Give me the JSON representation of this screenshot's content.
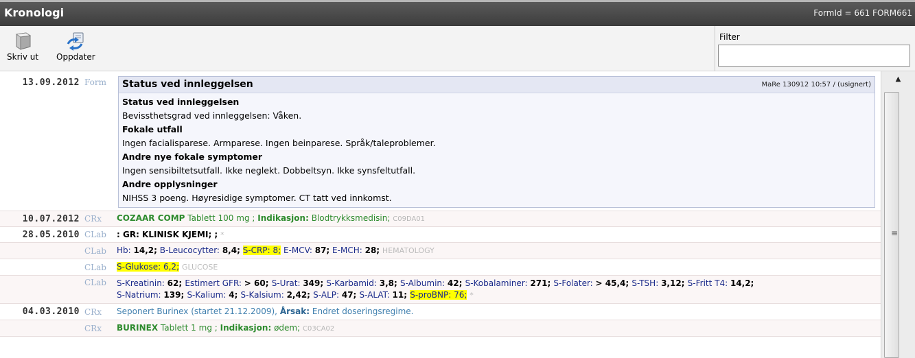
{
  "window": {
    "title": "Kronologi",
    "form_id": "FormId = 661 FORM661"
  },
  "toolbar": {
    "print": {
      "label": "Skriv ut",
      "icon": "printer-icon"
    },
    "refresh": {
      "label": "Oppdater",
      "icon": "refresh-icon"
    },
    "filter": {
      "label": "Filter",
      "value": ""
    }
  },
  "entries": {
    "e1": {
      "date": "13.09.2012",
      "type": "Form",
      "form_title": "Status ved innleggelsen",
      "signature": "MaRe 130912 10:57 / (usignert)",
      "lines": [
        "Status ved innleggelsen",
        "Bevissthetsgrad ved innleggelsen: Våken.",
        "Fokale utfall",
        "Ingen facialisparese. Armparese. Ingen beinparese. Språk/taleproblemer.",
        "Andre nye fokale symptomer",
        "Ingen sensibiltetsutfall. Ikke neglekt. Dobbeltsyn. Ikke synsfeltutfall.",
        "Andre opplysninger",
        "NIHSS 3 poeng. Høyresidige symptomer. CT tatt ved innkomst."
      ]
    },
    "e2": {
      "date": "10.07.2012",
      "type": "CRx",
      "drug": "COZAAR COMP",
      "form": "Tablett 100 mg ;",
      "ind_label": "Indikasjon:",
      "indication": "Blodtrykksmedisin;",
      "code": "C09DA01"
    },
    "e3": {
      "date": "28.05.2010",
      "type": "CLab",
      "text": ": GR: KLINISK KJEMI; ;",
      "mark": "*"
    },
    "e4": {
      "type": "CLab",
      "hb_label": "Hb:",
      "hb": "14,2;",
      "leu_label": "B-Leucocytter:",
      "leu": "8,4;",
      "crp": "S-CRP: 8;",
      "mcv_label": "E-MCV:",
      "mcv": "87;",
      "mch_label": "E-MCH:",
      "mch": "28;",
      "group": "HEMATOLOGY"
    },
    "e5": {
      "type": "CLab",
      "glu": "S-Glukose: 6,2;",
      "group": "GLUCOSE"
    },
    "e6": {
      "type": "CLab",
      "line1": [
        [
          "S-Kreatinin:",
          "62;"
        ],
        [
          "Estimert GFR:",
          "> 60;"
        ],
        [
          "S-Urat:",
          "349;"
        ],
        [
          "S-Karbamid:",
          "3,8;"
        ],
        [
          "S-Albumin:",
          "42;"
        ],
        [
          "S-Kobalaminer:",
          "271;"
        ],
        [
          "S-Folater:",
          "> 45,4;"
        ],
        [
          "S-TSH:",
          "3,12;"
        ],
        [
          "S-Fritt T4:",
          "14,2;"
        ]
      ],
      "line2": [
        [
          "S-Natrium:",
          "139;"
        ],
        [
          "S-Kalium:",
          "4;"
        ],
        [
          "S-Kalsium:",
          "2,42;"
        ],
        [
          "S-ALP:",
          "47;"
        ],
        [
          "S-ALAT:",
          "11;"
        ]
      ],
      "bnp": "S-proBNP: 76;",
      "mark": "*"
    },
    "e7": {
      "date": "04.03.2010",
      "type": "CRx",
      "text1": "Seponert",
      "drug": "Burinex",
      "text2": "(startet 21.12.2009),",
      "reason_label": "Årsak:",
      "reason": "Endret doseringsregime."
    },
    "e8": {
      "type": "CRx",
      "drug": "BURINEX",
      "form": "Tablett 1 mg ;",
      "ind_label": "Indikasjon:",
      "indication": "ødem;",
      "code": "C03CA02"
    }
  },
  "colors": {
    "titlebar": "#474747",
    "highlight": "#ffff00",
    "drug_green": "#2e8b2e",
    "form_border": "#b8c0d8"
  }
}
